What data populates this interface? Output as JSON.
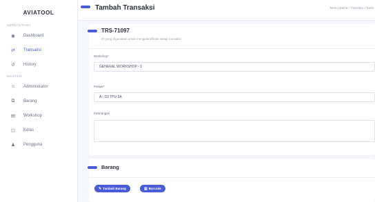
{
  "brand": "AVIATOOL",
  "sidebar": {
    "menu_label": "MENU UTAMA",
    "master_label": "MASTER",
    "menu_items": [
      {
        "label": "Dashboard",
        "icon": "dashboard-icon",
        "glyph": "◉",
        "active": false
      },
      {
        "label": "Transaksi",
        "icon": "transfer-icon",
        "glyph": "⇄",
        "active": true
      },
      {
        "label": "History",
        "icon": "history-icon",
        "glyph": "↺",
        "active": false
      }
    ],
    "master_items": [
      {
        "label": "Administrator",
        "icon": "users-icon",
        "glyph": "☺"
      },
      {
        "label": "Barang",
        "icon": "boxes-icon",
        "glyph": "⧉"
      },
      {
        "label": "Workshop",
        "icon": "warehouse-icon",
        "glyph": "▤"
      },
      {
        "label": "Kelas",
        "icon": "chalkboard-icon",
        "glyph": "◫"
      },
      {
        "label": "Pengguna",
        "icon": "user-icon",
        "glyph": "♟"
      }
    ]
  },
  "header": {
    "title": "Tambah Transaksi",
    "breadcrumb": "Menu Utama / Transaksi / Tamb"
  },
  "form": {
    "code": "TRS-71097",
    "hint": "ID yang digunakan untuk mengidentifikasi setiap transaksi.",
    "workshop_label": "Workshop*",
    "workshop_value": "GENERAL WORKSHOP - 1",
    "pelajar_label": "Pelajar*",
    "pelajar_value": "A - D3 TPU 5A",
    "keterangan_label": "Keterangan",
    "keterangan_value": ""
  },
  "barang": {
    "heading": "Barang",
    "add_button": "Tambah Barang",
    "barcode_button": "Barcode"
  },
  "colors": {
    "accent": "#4a5bd8"
  }
}
